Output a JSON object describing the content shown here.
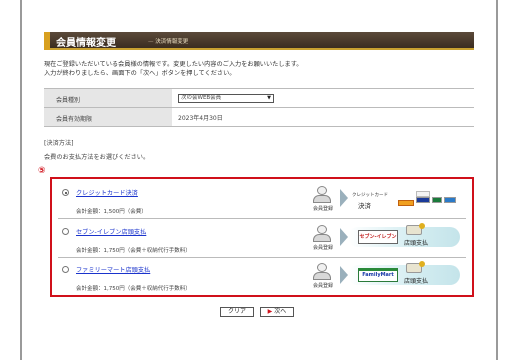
{
  "header": {
    "title": "会員情報変更",
    "subtitle": "決済情報変更"
  },
  "intro": {
    "line1": "現在ご登録いただいている会員様の情報です。変更したい内容のご入力をお願いいたします。",
    "line2": "入力が終わりましたら、画面下の「次へ」ボタンを押してください。"
  },
  "info": {
    "rows": [
      {
        "label": "会員種別",
        "value": "次の会WEB会員",
        "type": "select"
      },
      {
        "label": "会員有効期限",
        "value": "2023年4月30日",
        "type": "text"
      }
    ]
  },
  "section": {
    "title": "[決済方法]",
    "description": "会費のお支払方法をお選びください。",
    "marker": "⑤"
  },
  "payment_options": [
    {
      "label": "クレジットカード決済",
      "amount": "会計金額：1,500円（会費）",
      "checked": true,
      "member_label": "会員登録",
      "kind": "credit",
      "card_label": "クレジットカード",
      "kessai": "決済",
      "card_logos": [
        "VeriSign",
        "VISA",
        "MasterCard",
        "JCB",
        "AMEX"
      ]
    },
    {
      "label": "セブン-イレブン店頭支払",
      "amount": "会計金額：1,750円（会費＋収納代行手数料）",
      "checked": false,
      "member_label": "会員登録",
      "kind": "store",
      "store_logo": "セブン-イレブン",
      "store_pay": "店頭支払"
    },
    {
      "label": "ファミリーマート店頭支払",
      "amount": "会計金額：1,750円（会費＋収納代行手数料）",
      "checked": false,
      "member_label": "会員登録",
      "kind": "store",
      "store_logo": "FamilyMart",
      "store_pay": "店頭支払"
    }
  ],
  "buttons": {
    "clear": "クリア",
    "next": "次へ"
  },
  "colors": {
    "accent_red": "#d0101a",
    "header_brown": "#4a3a2c",
    "link_blue": "#1a33cc"
  }
}
